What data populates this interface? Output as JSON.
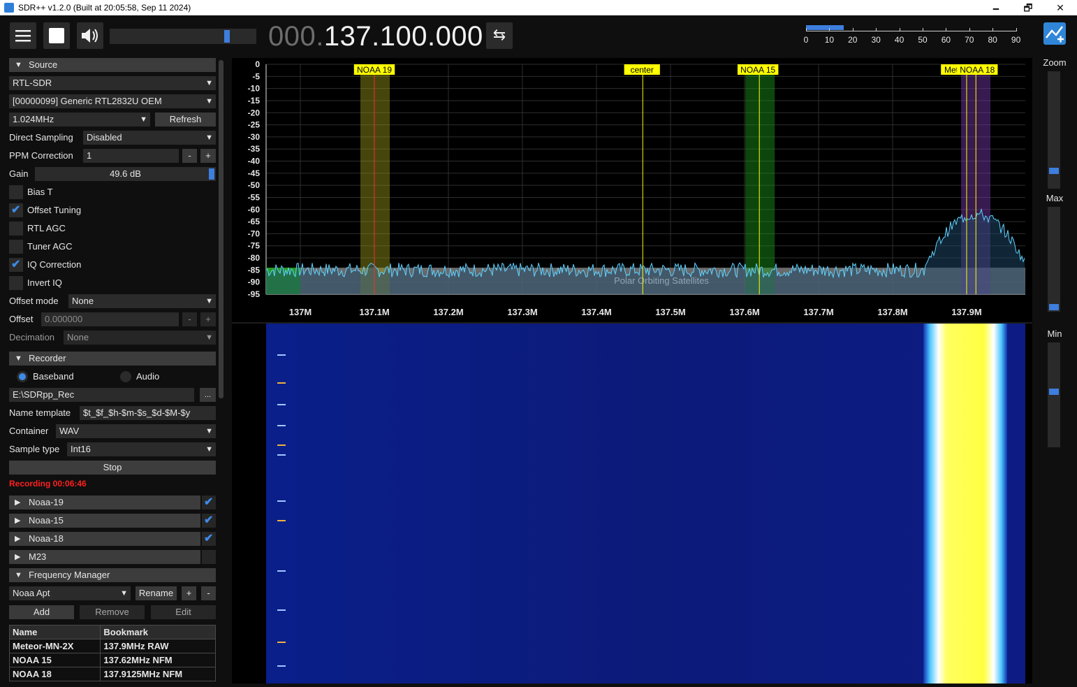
{
  "window": {
    "title": "SDR++ v1.2.0 (Built at 20:05:58, Sep 11 2024)",
    "minimize": "🗕",
    "maximize": "🗗",
    "close": "✕"
  },
  "toolbar": {
    "menu_icon": "hamburger-menu-icon",
    "stop_icon": "stop-square-icon",
    "volume_icon": "speaker-icon",
    "volume_level": 0.82,
    "freq_dim": "000.",
    "freq_bright": "137.100.000",
    "swap_icon": "⇆",
    "snr_scale": [
      "0",
      "10",
      "20",
      "30",
      "40",
      "50",
      "60",
      "70",
      "80",
      "90"
    ],
    "snr_level": 0.06
  },
  "source": {
    "header": "Source",
    "device_type": "RTL-SDR",
    "device": "[00000099] Generic RTL2832U OEM",
    "samplerate": "1.024MHz",
    "refresh": "Refresh",
    "direct_sampling_label": "Direct Sampling",
    "direct_sampling": "Disabled",
    "ppm_label": "PPM Correction",
    "ppm_value": "1",
    "minus": "-",
    "plus": "+",
    "gain_label": "Gain",
    "gain_value": "49.6 dB",
    "bias_t": "Bias T",
    "offset_tuning": "Offset Tuning",
    "rtl_agc": "RTL AGC",
    "tuner_agc": "Tuner AGC",
    "iq_correction": "IQ Correction",
    "invert_iq": "Invert IQ",
    "offset_mode_label": "Offset mode",
    "offset_mode": "None",
    "offset_label": "Offset",
    "offset_value": "0.000000",
    "decimation_label": "Decimation",
    "decimation": "None"
  },
  "recorder": {
    "header": "Recorder",
    "baseband": "Baseband",
    "audio": "Audio",
    "path": "E:\\SDRpp_Rec",
    "browse": "...",
    "name_template_label": "Name template",
    "name_template": "$t_$f_$h-$m-$s_$d-$M-$y",
    "container_label": "Container",
    "container": "WAV",
    "sample_type_label": "Sample type",
    "sample_type": "Int16",
    "stop": "Stop",
    "status": "Recording 00:06:46"
  },
  "modules": [
    {
      "label": "Noaa-19",
      "enabled": true
    },
    {
      "label": "Noaa-15",
      "enabled": true
    },
    {
      "label": "Noaa-18",
      "enabled": true
    },
    {
      "label": "M23",
      "enabled": false
    }
  ],
  "freq_manager": {
    "header": "Frequency Manager",
    "list": "Noaa Apt",
    "rename": "Rename",
    "plus": "+",
    "minus": "-",
    "add": "Add",
    "remove": "Remove",
    "edit": "Edit",
    "col_name": "Name",
    "col_bookmark": "Bookmark",
    "bookmarks": [
      {
        "name": "Meteor-MN-2X",
        "bookmark": "137.9MHz RAW"
      },
      {
        "name": "NOAA 15",
        "bookmark": "137.62MHz NFM"
      },
      {
        "name": "NOAA 18",
        "bookmark": "137.9125MHz NFM"
      }
    ]
  },
  "spectrum": {
    "db_ticks": [
      "0",
      "-5",
      "-10",
      "-15",
      "-20",
      "-25",
      "-30",
      "-35",
      "-40",
      "-45",
      "-50",
      "-55",
      "-60",
      "-65",
      "-70",
      "-75",
      "-80",
      "-85",
      "-90",
      "-95"
    ],
    "freq_ticks": [
      "137M",
      "137.1M",
      "137.2M",
      "137.3M",
      "137.4M",
      "137.5M",
      "137.6M",
      "137.7M",
      "137.8M",
      "137.9M"
    ],
    "band_label": "Polar Orbiting Satellites",
    "vfos": [
      {
        "label": "NOAA 19",
        "freq_mhz": 137.1,
        "color": "#9c9c1a"
      },
      {
        "label": "center",
        "freq_mhz": 137.4625,
        "color": "#ffff00"
      },
      {
        "label": "NOAA 15",
        "freq_mhz": 137.62,
        "color": "#1a9c1a"
      },
      {
        "label": "Met",
        "freq_mhz": 137.9,
        "color": "#7a3ab0"
      },
      {
        "label": "NOAA 18",
        "freq_mhz": 137.9125,
        "color": "#7a3ab0"
      }
    ]
  },
  "right": {
    "zoom": "Zoom",
    "max": "Max",
    "min": "Min",
    "zoom_level": 0.12,
    "max_level": 0.02,
    "min_level": 0.6
  },
  "app_icon": "sdrpp-logo-icon"
}
